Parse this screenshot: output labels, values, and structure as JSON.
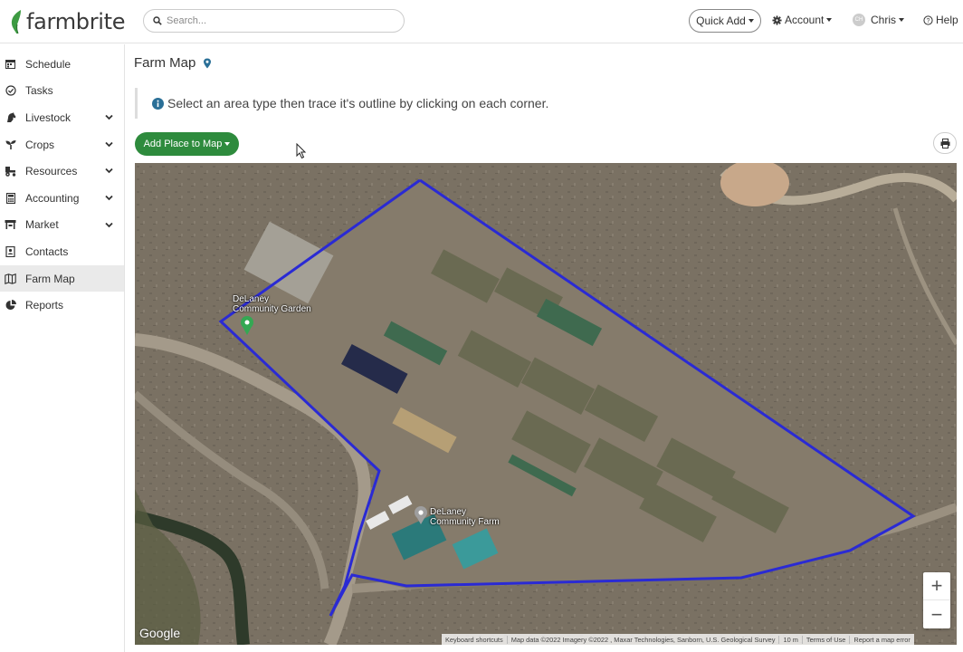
{
  "app": {
    "logo_text": "farmbrite"
  },
  "header": {
    "search_placeholder": "Search...",
    "quick_add": "Quick Add",
    "account": "Account",
    "user": "Chris",
    "user_initials": "CH",
    "help": "Help"
  },
  "sidebar": {
    "items": [
      {
        "label": "Schedule",
        "icon": "calendar-icon",
        "expandable": false
      },
      {
        "label": "Tasks",
        "icon": "check-circle-icon",
        "expandable": false
      },
      {
        "label": "Livestock",
        "icon": "horse-icon",
        "expandable": true
      },
      {
        "label": "Crops",
        "icon": "seedling-icon",
        "expandable": true
      },
      {
        "label": "Resources",
        "icon": "tractor-icon",
        "expandable": true
      },
      {
        "label": "Accounting",
        "icon": "calculator-icon",
        "expandable": true
      },
      {
        "label": "Market",
        "icon": "store-icon",
        "expandable": true
      },
      {
        "label": "Contacts",
        "icon": "address-book-icon",
        "expandable": false
      },
      {
        "label": "Farm Map",
        "icon": "map-icon",
        "expandable": false,
        "active": true
      },
      {
        "label": "Reports",
        "icon": "pie-chart-icon",
        "expandable": false
      }
    ]
  },
  "main": {
    "title": "Farm Map",
    "info_text": "Select an area type then trace it's outline by clicking on each corner.",
    "add_place_button": "Add Place to Map"
  },
  "map": {
    "labels": {
      "garden_line1": "DeLaney",
      "garden_line2": "Community Garden",
      "farm_line1": "DeLaney",
      "farm_line2": "Community Farm"
    },
    "zoom_in": "+",
    "zoom_out": "−",
    "google_logo": "Google",
    "attribution": {
      "shortcuts": "Keyboard shortcuts",
      "data": "Map data ©2022 Imagery ©2022 , Maxar Technologies, Sanborn, U.S. Geological Survey",
      "scale": "10 m",
      "terms": "Terms of Use",
      "report": "Report a map error"
    },
    "outline_color": "#2a2ad4"
  },
  "colors": {
    "brand_green": "#2e8b3d",
    "logo_leaf": "#3d9b42"
  }
}
